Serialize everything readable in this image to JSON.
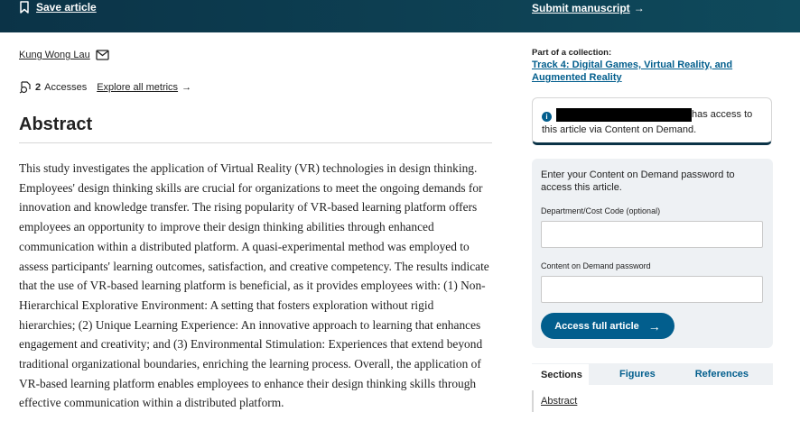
{
  "header": {
    "save_label": "Save article",
    "submit_label": "Submit manuscript",
    "submit_arrow": "→"
  },
  "author": {
    "name": "Kung Wong Lau"
  },
  "metrics": {
    "count": "2",
    "accesses_label": "Accesses",
    "explore_label": "Explore all metrics",
    "explore_arrow": "→"
  },
  "abstract": {
    "heading": "Abstract",
    "text": "This study investigates the application of Virtual Reality (VR) technologies in design thinking. Employees' design thinking skills are crucial for organizations to meet the ongoing demands for innovation and knowledge transfer. The rising popularity of VR-based learning platform offers employees an opportunity to improve their design thinking abilities through enhanced communication within a distributed platform. A quasi-experimental method was employed to assess participants' learning outcomes, satisfaction, and creative competency. The results indicate that the use of VR-based learning platform is beneficial, as it provides employees with: (1) Non-Hierarchical Explorative Environment: A setting that fosters exploration without rigid hierarchies; (2) Unique Learning Experience: An innovative approach to learning that enhances engagement and creativity; and (3) Environmental Stimulation: Experiences that extend beyond traditional organizational boundaries, enriching the learning process. Overall, the application of VR-based learning platform enables employees to enhance their design thinking skills through effective communication within a distributed platform."
  },
  "sidebar": {
    "collection_label": "Part of a collection:",
    "collection_link": "Track 4: Digital Games, Virtual Reality, and Augmented Reality",
    "access_line1": "has access to",
    "access_line2": "this article via Content on Demand.",
    "info_glyph": "i",
    "cod_intro": "Enter your Content on Demand password to access this article.",
    "department_label": "Department/Cost Code (optional)",
    "department_value": "",
    "password_label": "Content on Demand password",
    "password_value": "",
    "access_button": "Access full article",
    "access_button_arrow": "→",
    "tabs": [
      {
        "label": "Sections"
      },
      {
        "label": "Figures"
      },
      {
        "label": "References"
      }
    ],
    "section_item": "Abstract"
  },
  "colors": {
    "header_bg": "#0b3347",
    "link": "#025e8d",
    "button": "#025e8d",
    "panel_bg": "#eef1f4"
  }
}
